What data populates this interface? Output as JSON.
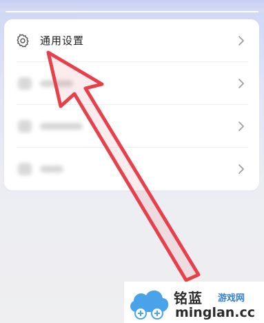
{
  "settings": {
    "items": [
      {
        "label": "通用设置",
        "icon": "gear-icon"
      },
      {
        "label": "",
        "icon": "blurred-icon"
      },
      {
        "label": "",
        "icon": "blurred-icon"
      },
      {
        "label": "",
        "icon": "blurred-icon"
      }
    ]
  },
  "annotation": {
    "color": "#e8404a"
  },
  "watermark": {
    "brand": "铭蓝",
    "site": "游戏网",
    "domain": "minglan.cc",
    "brand_color": "#2b2b2b",
    "accent_color": "#2f7fd6"
  }
}
